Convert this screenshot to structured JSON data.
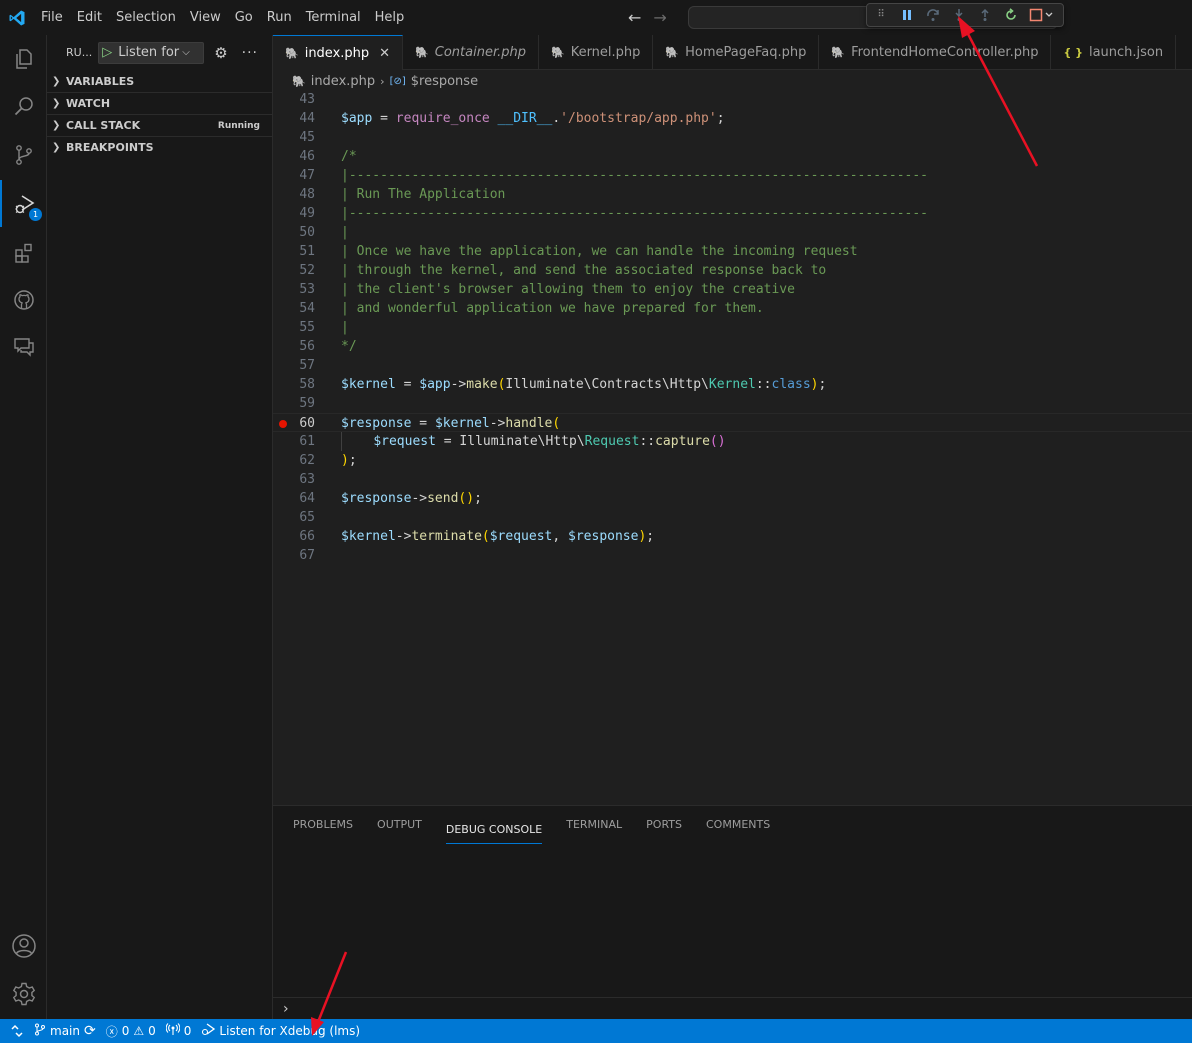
{
  "menu": [
    "File",
    "Edit",
    "Selection",
    "View",
    "Go",
    "Run",
    "Terminal",
    "Help"
  ],
  "sidebar": {
    "title": "RU...",
    "run_config": "Listen for Xdebug",
    "sections": [
      {
        "label": "VARIABLES",
        "state": ""
      },
      {
        "label": "WATCH",
        "state": ""
      },
      {
        "label": "CALL STACK",
        "state": "Running"
      },
      {
        "label": "BREAKPOINTS",
        "state": ""
      }
    ]
  },
  "activity": {
    "debug_badge": "1"
  },
  "tabs": [
    {
      "label": "index.php",
      "active": true,
      "italic": false,
      "kind": "php"
    },
    {
      "label": "Container.php",
      "active": false,
      "italic": true,
      "kind": "php"
    },
    {
      "label": "Kernel.php",
      "active": false,
      "italic": false,
      "kind": "php"
    },
    {
      "label": "HomePageFaq.php",
      "active": false,
      "italic": false,
      "kind": "php"
    },
    {
      "label": "FrontendHomeController.php",
      "active": false,
      "italic": false,
      "kind": "php"
    },
    {
      "label": "launch.json",
      "active": false,
      "italic": false,
      "kind": "json"
    }
  ],
  "breadcrumb": {
    "file": "index.php",
    "symbol": "$response"
  },
  "editor": {
    "current_line": 60,
    "breakpoint_line": 60,
    "lines": [
      {
        "n": 43,
        "t": []
      },
      {
        "n": 44,
        "t": [
          [
            "var",
            "$app"
          ],
          [
            "def",
            " = "
          ],
          [
            "kw",
            "require_once"
          ],
          [
            "def",
            " "
          ],
          [
            "const",
            "__DIR__"
          ],
          [
            "def",
            "."
          ],
          [
            "str",
            "'/bootstrap/app.php'"
          ],
          [
            "def",
            ";"
          ]
        ]
      },
      {
        "n": 45,
        "t": []
      },
      {
        "n": 46,
        "t": [
          [
            "com",
            "/*"
          ]
        ]
      },
      {
        "n": 47,
        "t": [
          [
            "com",
            "|--------------------------------------------------------------------------"
          ]
        ]
      },
      {
        "n": 48,
        "t": [
          [
            "com",
            "| Run The Application"
          ]
        ]
      },
      {
        "n": 49,
        "t": [
          [
            "com",
            "|--------------------------------------------------------------------------"
          ]
        ]
      },
      {
        "n": 50,
        "t": [
          [
            "com",
            "|"
          ]
        ]
      },
      {
        "n": 51,
        "t": [
          [
            "com",
            "| Once we have the application, we can handle the incoming request"
          ]
        ]
      },
      {
        "n": 52,
        "t": [
          [
            "com",
            "| through the kernel, and send the associated response back to"
          ]
        ]
      },
      {
        "n": 53,
        "t": [
          [
            "com",
            "| the client's browser allowing them to enjoy the creative"
          ]
        ]
      },
      {
        "n": 54,
        "t": [
          [
            "com",
            "| and wonderful application we have prepared for them."
          ]
        ]
      },
      {
        "n": 55,
        "t": [
          [
            "com",
            "|"
          ]
        ]
      },
      {
        "n": 56,
        "t": [
          [
            "com",
            "*/"
          ]
        ]
      },
      {
        "n": 57,
        "t": []
      },
      {
        "n": 58,
        "t": [
          [
            "var",
            "$kernel"
          ],
          [
            "def",
            " = "
          ],
          [
            "var",
            "$app"
          ],
          [
            "def",
            "->"
          ],
          [
            "fn",
            "make"
          ],
          [
            "br1",
            "("
          ],
          [
            "def",
            "Illuminate\\Contracts\\Http\\"
          ],
          [
            "cls",
            "Kernel"
          ],
          [
            "def",
            "::"
          ],
          [
            "blue",
            "class"
          ],
          [
            "br1",
            ")"
          ],
          [
            "def",
            ";"
          ]
        ]
      },
      {
        "n": 59,
        "t": []
      },
      {
        "n": 60,
        "t": [
          [
            "var",
            "$response"
          ],
          [
            "def",
            " = "
          ],
          [
            "var",
            "$kernel"
          ],
          [
            "def",
            "->"
          ],
          [
            "fn",
            "handle"
          ],
          [
            "br1",
            "("
          ]
        ]
      },
      {
        "n": 61,
        "t": [
          [
            "indent",
            "    "
          ],
          [
            "var",
            "$request"
          ],
          [
            "def",
            " = Illuminate\\Http\\"
          ],
          [
            "cls",
            "Request"
          ],
          [
            "def",
            "::"
          ],
          [
            "fn",
            "capture"
          ],
          [
            "br2",
            "()"
          ]
        ]
      },
      {
        "n": 62,
        "t": [
          [
            "br1",
            ")"
          ],
          [
            "def",
            ";"
          ]
        ]
      },
      {
        "n": 63,
        "t": []
      },
      {
        "n": 64,
        "t": [
          [
            "var",
            "$response"
          ],
          [
            "def",
            "->"
          ],
          [
            "fn",
            "send"
          ],
          [
            "br1",
            "()"
          ],
          [
            "def",
            ";"
          ]
        ]
      },
      {
        "n": 65,
        "t": []
      },
      {
        "n": 66,
        "t": [
          [
            "var",
            "$kernel"
          ],
          [
            "def",
            "->"
          ],
          [
            "fn",
            "terminate"
          ],
          [
            "br1",
            "("
          ],
          [
            "var",
            "$request"
          ],
          [
            "def",
            ", "
          ],
          [
            "var",
            "$response"
          ],
          [
            "br1",
            ")"
          ],
          [
            "def",
            ";"
          ]
        ]
      },
      {
        "n": 67,
        "t": []
      }
    ]
  },
  "panel": {
    "tabs": [
      "PROBLEMS",
      "OUTPUT",
      "DEBUG CONSOLE",
      "TERMINAL",
      "PORTS",
      "COMMENTS"
    ],
    "active_tab": "DEBUG CONSOLE",
    "prompt": "›"
  },
  "statusbar": {
    "branch": "main",
    "errors": "0",
    "warnings": "0",
    "ports": "0",
    "debug_config": "Listen for Xdebug (lms)"
  },
  "colors": {
    "accent": "#0078d4",
    "breakpoint": "#e51400",
    "annotation_arrow": "#e81123"
  }
}
